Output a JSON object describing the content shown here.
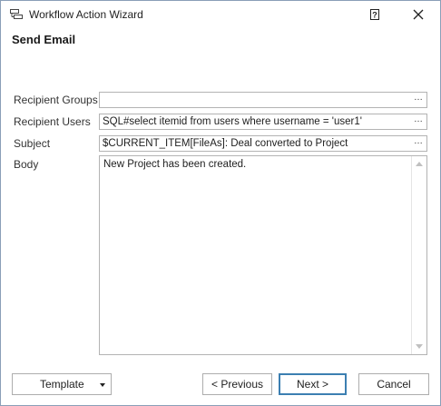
{
  "window": {
    "title": "Workflow Action Wizard",
    "help_label": "?"
  },
  "header": {
    "title": "Send Email"
  },
  "fields": {
    "recipient_groups": {
      "label": "Recipient Groups",
      "value": ""
    },
    "recipient_users": {
      "label": "Recipient Users",
      "value": "SQL#select itemid from users where username = 'user1'"
    },
    "subject": {
      "label": "Subject",
      "value": "$CURRENT_ITEM[FileAs]: Deal converted to Project"
    },
    "body": {
      "label": "Body",
      "value": "New Project has been created."
    },
    "ellipsis": "…"
  },
  "buttons": {
    "template": "Template",
    "previous": "< Previous",
    "next": "Next >",
    "cancel": "Cancel"
  },
  "colors": {
    "primary_border": "#3c7fb1",
    "window_border": "#8a9fb8"
  }
}
